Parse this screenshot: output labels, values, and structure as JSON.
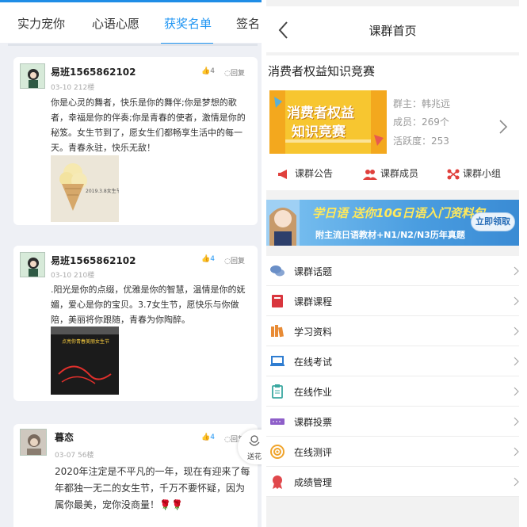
{
  "left": {
    "tabs": [
      "实力宠你",
      "心语心愿",
      "获奖名单",
      "签名"
    ],
    "active_tab": 2,
    "posts": [
      {
        "username": "易班1565862102",
        "meta": "03-10 212楼",
        "likes": "4",
        "reply_label": "回复",
        "text": "你是心灵的舞者，快乐是你的舞伴;你是梦想的歌者，幸福是你的伴奏;你是青春的使者，激情是你的秘笈。女生节到了，愿女生们都畅享生活中的每一天。青春永驻，快乐无敌！",
        "image_caption": "2019.3.8女生节快乐"
      },
      {
        "username": "易班1565862102",
        "meta": "03-10 210楼",
        "likes": "4",
        "reply_label": "回复",
        "text": ".阳光是你的点缀，优雅是你的智慧，温情是你的妩媚，爱心是你的宝贝。3.7女生节，愿快乐与你做陪，美丽将你跟随，青春为你陶醉。",
        "image_caption": "点亮你青春美丽女生节"
      },
      {
        "username": "暮恋",
        "meta": "03-07 56楼",
        "likes": "4",
        "reply_label": "回复",
        "text": "2020年注定是不平凡的一年，现在有迎来了每年都独一无二的女生节，千万不要怀疑，因为属你最美，宠你没商量！🌹🌹"
      }
    ],
    "send_flower_label": "送花"
  },
  "right": {
    "nav_title": "课群首页",
    "group": {
      "name": "消费者权益知识竞赛",
      "cover_line1": "消费者权益",
      "cover_line2": "知识竞赛",
      "owner": "群主：韩兆远",
      "members": "成员：269个",
      "activity": "活跃度：253"
    },
    "quick_links": [
      "课群公告",
      "课群成员",
      "课群小组"
    ],
    "banner": {
      "line1": "学日语 送你10G日语入门资料包",
      "line2": "附主流日语教材+N1/N2/N3历年真题",
      "button": "立即领取"
    },
    "menu": [
      {
        "label": "课群话题",
        "icon": "chat-bubbles-icon",
        "color": "#6a8fc7"
      },
      {
        "label": "课群课程",
        "icon": "book-icon",
        "color": "#d9363e"
      },
      {
        "label": "学习资料",
        "icon": "library-icon",
        "color": "#e88b35"
      },
      {
        "label": "在线考试",
        "icon": "laptop-icon",
        "color": "#2f7dd1"
      },
      {
        "label": "在线作业",
        "icon": "clipboard-icon",
        "color": "#3aa8a0"
      },
      {
        "label": "课群投票",
        "icon": "ticket-icon",
        "color": "#8e5fc9"
      },
      {
        "label": "在线测评",
        "icon": "target-icon",
        "color": "#f0a42c"
      },
      {
        "label": "成绩管理",
        "icon": "medal-icon",
        "color": "#e0484c"
      }
    ]
  },
  "colors": {
    "accent": "#2196f3",
    "left_bg": "#eef0f5",
    "right_bg": "#f2f2f2"
  }
}
